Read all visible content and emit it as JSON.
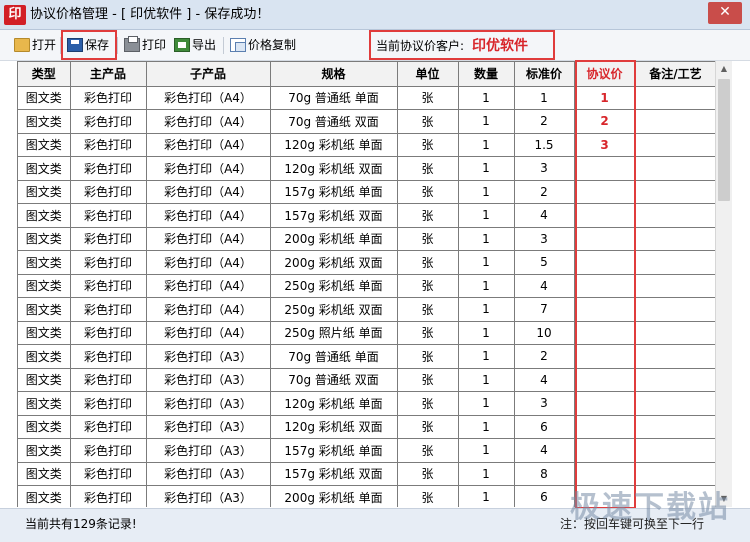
{
  "window": {
    "app_icon_char": "印",
    "title": "协议价格管理 - [ 印优软件 ] - 保存成功！",
    "close_glyph": "✕"
  },
  "toolbar": {
    "open_label": "打开",
    "save_label": "保存",
    "print_label": "打印",
    "export_label": "导出",
    "price_copy_label": "价格复制",
    "icons": [
      "folder-icon",
      "save-icon",
      "printer-icon",
      "export-icon",
      "copy-icon"
    ],
    "client_label": "当前协议价客户:",
    "client_name": "印优软件"
  },
  "table": {
    "columns": [
      "类型",
      "主产品",
      "子产品",
      "规格",
      "单位",
      "数量",
      "标准价",
      "协议价",
      "备注/工艺"
    ],
    "rows": [
      [
        "图文类",
        "彩色打印",
        "彩色打印（A4）",
        "70g 普通纸 单面",
        "张",
        "1",
        "1",
        "1",
        ""
      ],
      [
        "图文类",
        "彩色打印",
        "彩色打印（A4）",
        "70g 普通纸 双面",
        "张",
        "1",
        "2",
        "2",
        ""
      ],
      [
        "图文类",
        "彩色打印",
        "彩色打印（A4）",
        "120g 彩机纸 单面",
        "张",
        "1",
        "1.5",
        "3",
        ""
      ],
      [
        "图文类",
        "彩色打印",
        "彩色打印（A4）",
        "120g 彩机纸 双面",
        "张",
        "1",
        "3",
        "",
        ""
      ],
      [
        "图文类",
        "彩色打印",
        "彩色打印（A4）",
        "157g 彩机纸 单面",
        "张",
        "1",
        "2",
        "",
        ""
      ],
      [
        "图文类",
        "彩色打印",
        "彩色打印（A4）",
        "157g 彩机纸 双面",
        "张",
        "1",
        "4",
        "",
        ""
      ],
      [
        "图文类",
        "彩色打印",
        "彩色打印（A4）",
        "200g 彩机纸 单面",
        "张",
        "1",
        "3",
        "",
        ""
      ],
      [
        "图文类",
        "彩色打印",
        "彩色打印（A4）",
        "200g 彩机纸 双面",
        "张",
        "1",
        "5",
        "",
        ""
      ],
      [
        "图文类",
        "彩色打印",
        "彩色打印（A4）",
        "250g 彩机纸 单面",
        "张",
        "1",
        "4",
        "",
        ""
      ],
      [
        "图文类",
        "彩色打印",
        "彩色打印（A4）",
        "250g 彩机纸 双面",
        "张",
        "1",
        "7",
        "",
        ""
      ],
      [
        "图文类",
        "彩色打印",
        "彩色打印（A4）",
        "250g 照片纸 单面",
        "张",
        "1",
        "10",
        "",
        ""
      ],
      [
        "图文类",
        "彩色打印",
        "彩色打印（A3）",
        "70g 普通纸 单面",
        "张",
        "1",
        "2",
        "",
        ""
      ],
      [
        "图文类",
        "彩色打印",
        "彩色打印（A3）",
        "70g 普通纸 双面",
        "张",
        "1",
        "4",
        "",
        ""
      ],
      [
        "图文类",
        "彩色打印",
        "彩色打印（A3）",
        "120g 彩机纸 单面",
        "张",
        "1",
        "3",
        "",
        ""
      ],
      [
        "图文类",
        "彩色打印",
        "彩色打印（A3）",
        "120g 彩机纸 双面",
        "张",
        "1",
        "6",
        "",
        ""
      ],
      [
        "图文类",
        "彩色打印",
        "彩色打印（A3）",
        "157g 彩机纸 单面",
        "张",
        "1",
        "4",
        "",
        ""
      ],
      [
        "图文类",
        "彩色打印",
        "彩色打印（A3）",
        "157g 彩机纸 双面",
        "张",
        "1",
        "8",
        "",
        ""
      ],
      [
        "图文类",
        "彩色打印",
        "彩色打印（A3）",
        "200g 彩机纸 单面",
        "张",
        "1",
        "6",
        "",
        ""
      ]
    ]
  },
  "status": {
    "record_count": "当前共有129条记录!",
    "hint": "注：按回车键可换至下一行"
  },
  "watermark": "极速下载站",
  "colors": {
    "accent_red": "#d8262b",
    "highlight_frame": "#e03c3c",
    "titlebar": "#d9e4f1"
  }
}
